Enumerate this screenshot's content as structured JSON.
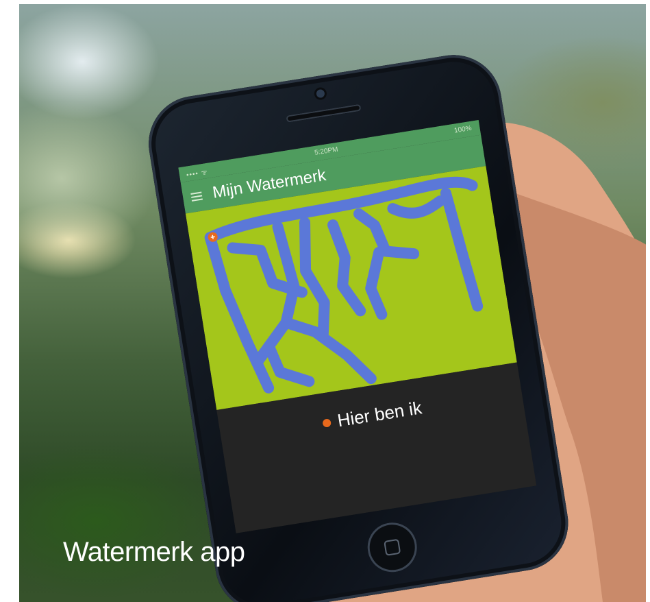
{
  "caption": "Watermerk app",
  "phone": {
    "status_carrier": "•••• ᯤ",
    "status_time": "5:20PM",
    "status_battery": "100%",
    "app_title": "Mijn Watermerk",
    "legend_text": "Hier ben ik"
  },
  "colors": {
    "map_land": "#a4c61b",
    "water": "#5b78d8",
    "location_marker": "#e8691c",
    "app_bar": "#4f9c5e",
    "panel": "#242424"
  },
  "icons": [
    "menu-icon",
    "location-marker-icon",
    "home-button-icon"
  ]
}
